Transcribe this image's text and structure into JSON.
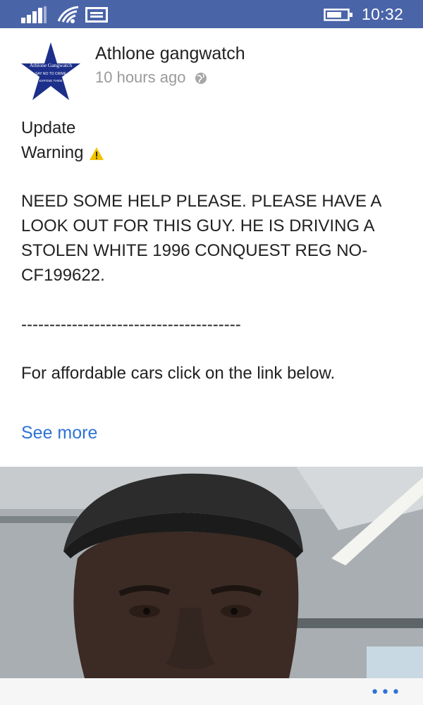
{
  "status_bar": {
    "time": "10:32",
    "icons": [
      "signal-icon",
      "wifi-icon",
      "message-icon",
      "battery-icon"
    ]
  },
  "post": {
    "author": "Athlone gangwatch",
    "time_ago": "10 hours ago",
    "avatar_text": {
      "line1": "Athlone Gangwatch",
      "line2": "SAY NO TO CRIME",
      "line3": "EXPOSE THEM"
    },
    "lines": [
      "Update",
      "Warning",
      "NEED SOME HELP PLEASE. PLEASE HAVE A",
      "LOOK OUT FOR THIS GUY. HE IS DRIVING A",
      "STOLEN WHITE 1996 CONQUEST REG NO-",
      "CF199622.",
      "---------------------------------------",
      "For affordable cars click on the link below."
    ],
    "see_more": "See more",
    "more_options": "•••"
  },
  "colors": {
    "status_bar": "#4a64a8",
    "link": "#2e73d6",
    "star": "#1c2f8a",
    "warning": "#f2c300"
  }
}
